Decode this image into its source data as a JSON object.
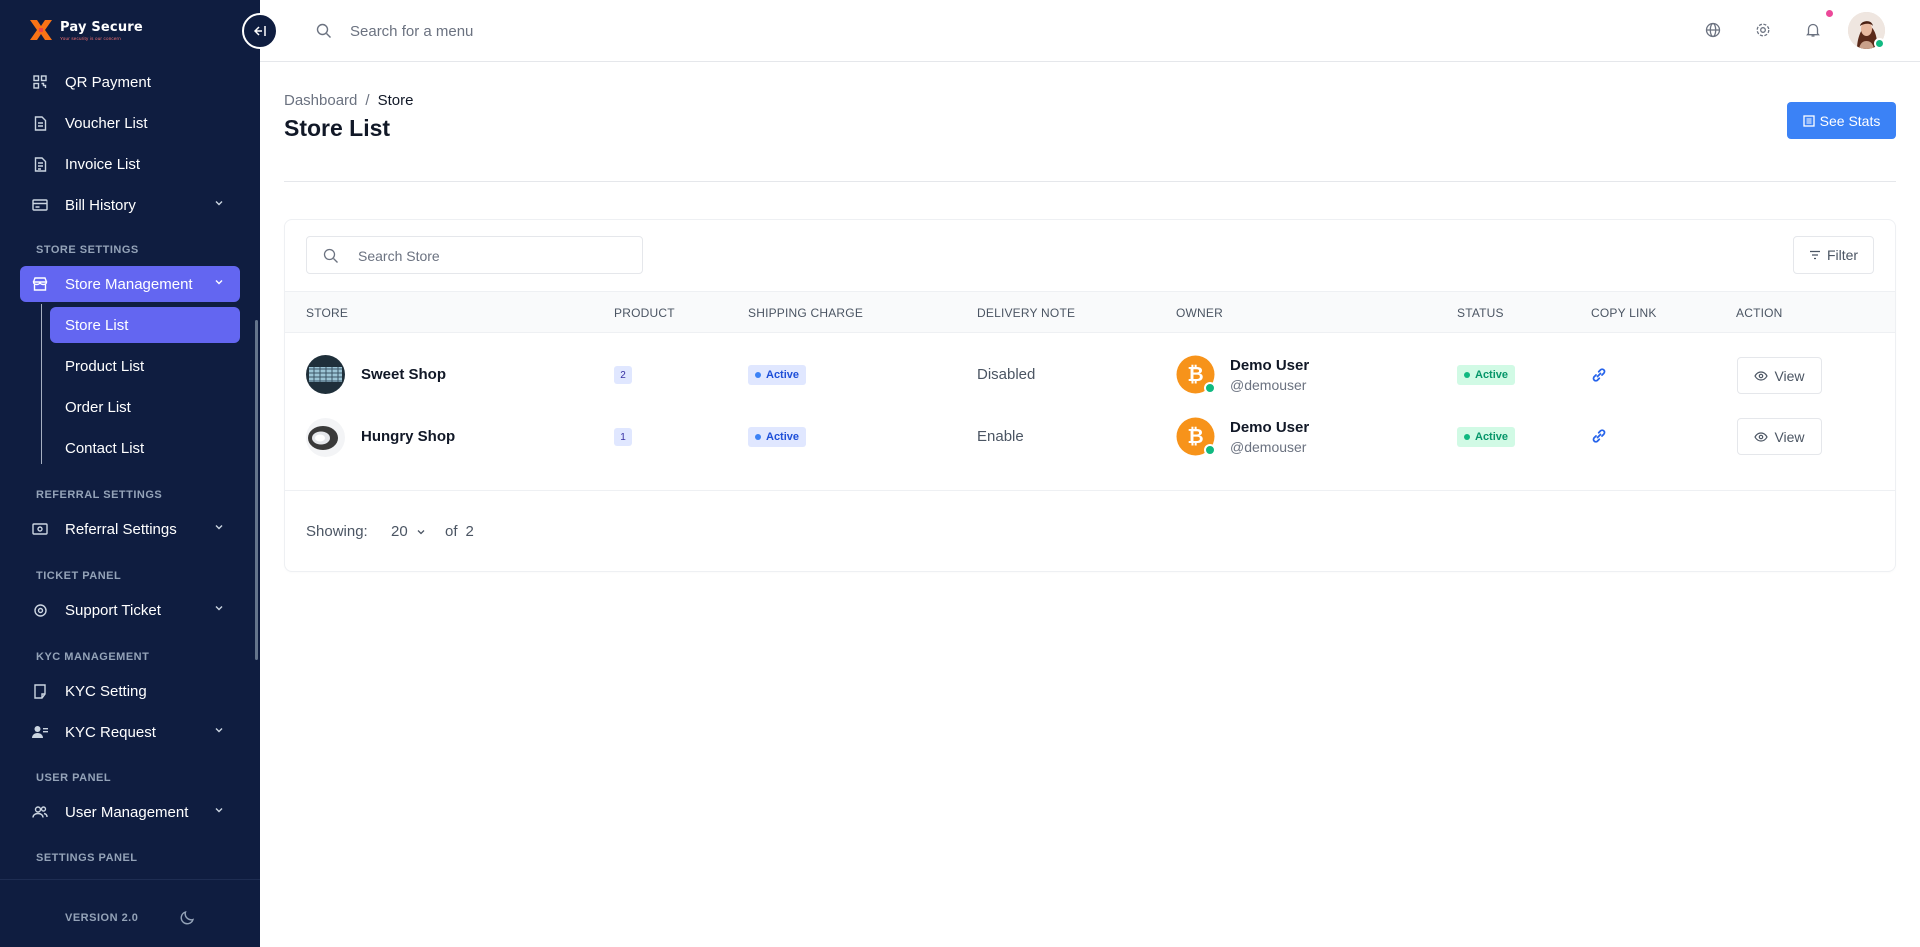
{
  "brand": {
    "name": "Pay Secure",
    "tagline": "Your security is our concern"
  },
  "sidebar": {
    "items": [
      {
        "label": "QR Payment"
      },
      {
        "label": "Voucher List"
      },
      {
        "label": "Invoice List"
      },
      {
        "label": "Bill History"
      }
    ],
    "sections": [
      {
        "label": "STORE SETTINGS"
      },
      {
        "label": "REFERRAL SETTINGS"
      },
      {
        "label": "TICKET PANEL"
      },
      {
        "label": "KYC MANAGEMENT"
      },
      {
        "label": "USER PANEL"
      },
      {
        "label": "SETTINGS PANEL"
      }
    ],
    "store_management": "Store Management",
    "store_sub": [
      "Store List",
      "Product List",
      "Order List",
      "Contact List"
    ],
    "referral_settings": "Referral Settings",
    "support_ticket": "Support Ticket",
    "kyc_setting": "KYC Setting",
    "kyc_request": "KYC Request",
    "user_management": "User Management",
    "version": "VERSION 2.0"
  },
  "header": {
    "search_placeholder": "Search for a menu"
  },
  "breadcrumb": {
    "root": "Dashboard",
    "sep": "/",
    "current": "Store"
  },
  "page": {
    "title": "Store List",
    "see_stats": "See Stats"
  },
  "table": {
    "search_placeholder": "Search Store",
    "filter_label": "Filter",
    "columns": [
      "STORE",
      "PRODUCT",
      "SHIPPING CHARGE",
      "DELIVERY NOTE",
      "OWNER",
      "STATUS",
      "COPY LINK",
      "ACTION"
    ],
    "rows": [
      {
        "store": "Sweet Shop",
        "product": "2",
        "shipping": "Active",
        "delivery": "Disabled",
        "owner_name": "Demo User",
        "owner_handle": "@demouser",
        "status": "Active",
        "action": "View"
      },
      {
        "store": "Hungry Shop",
        "product": "1",
        "shipping": "Active",
        "delivery": "Enable",
        "owner_name": "Demo User",
        "owner_handle": "@demouser",
        "status": "Active",
        "action": "View"
      }
    ],
    "footer": {
      "showing_label": "Showing:",
      "page_size": "20",
      "of_label": "of",
      "total": "2"
    }
  },
  "colors": {
    "sidebar_bg": "#0f1d40",
    "accent": "#6366f1",
    "primary": "#3b82f6",
    "success": "#10b981"
  }
}
